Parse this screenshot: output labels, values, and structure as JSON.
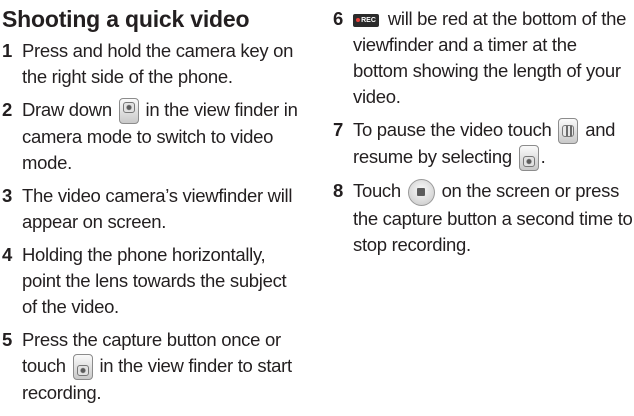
{
  "title": "Shooting a quick video",
  "steps": [
    {
      "num": "1",
      "text": "Press and hold the camera key on the right side of the phone."
    },
    {
      "num": "2",
      "pre": "Draw down",
      "icon": "camera-mode-switch-icon",
      "post": "in the view finder in camera mode to switch to video mode."
    },
    {
      "num": "3",
      "text": "The video camera’s viewfinder will appear on screen."
    },
    {
      "num": "4",
      "text": "Holding the phone horizontally, point the lens towards the subject of the video."
    },
    {
      "num": "5",
      "pre": "Press the capture button once or touch",
      "icon": "record-switch-icon",
      "post": "in the view finder to start recording."
    },
    {
      "num": "6",
      "icon": "rec-indicator-icon",
      "icon_label": "REC",
      "post": "will be red at the bottom of the viewfinder and a timer at the bottom showing the length of your video."
    },
    {
      "num": "7",
      "pre": "To pause the video touch",
      "icon": "pause-icon",
      "mid": "and resume by selecting",
      "icon2": "resume-icon",
      "post": "."
    },
    {
      "num": "8",
      "pre": "Touch",
      "icon": "stop-icon",
      "post": "on the screen or press the capture button a second time to stop recording."
    }
  ]
}
